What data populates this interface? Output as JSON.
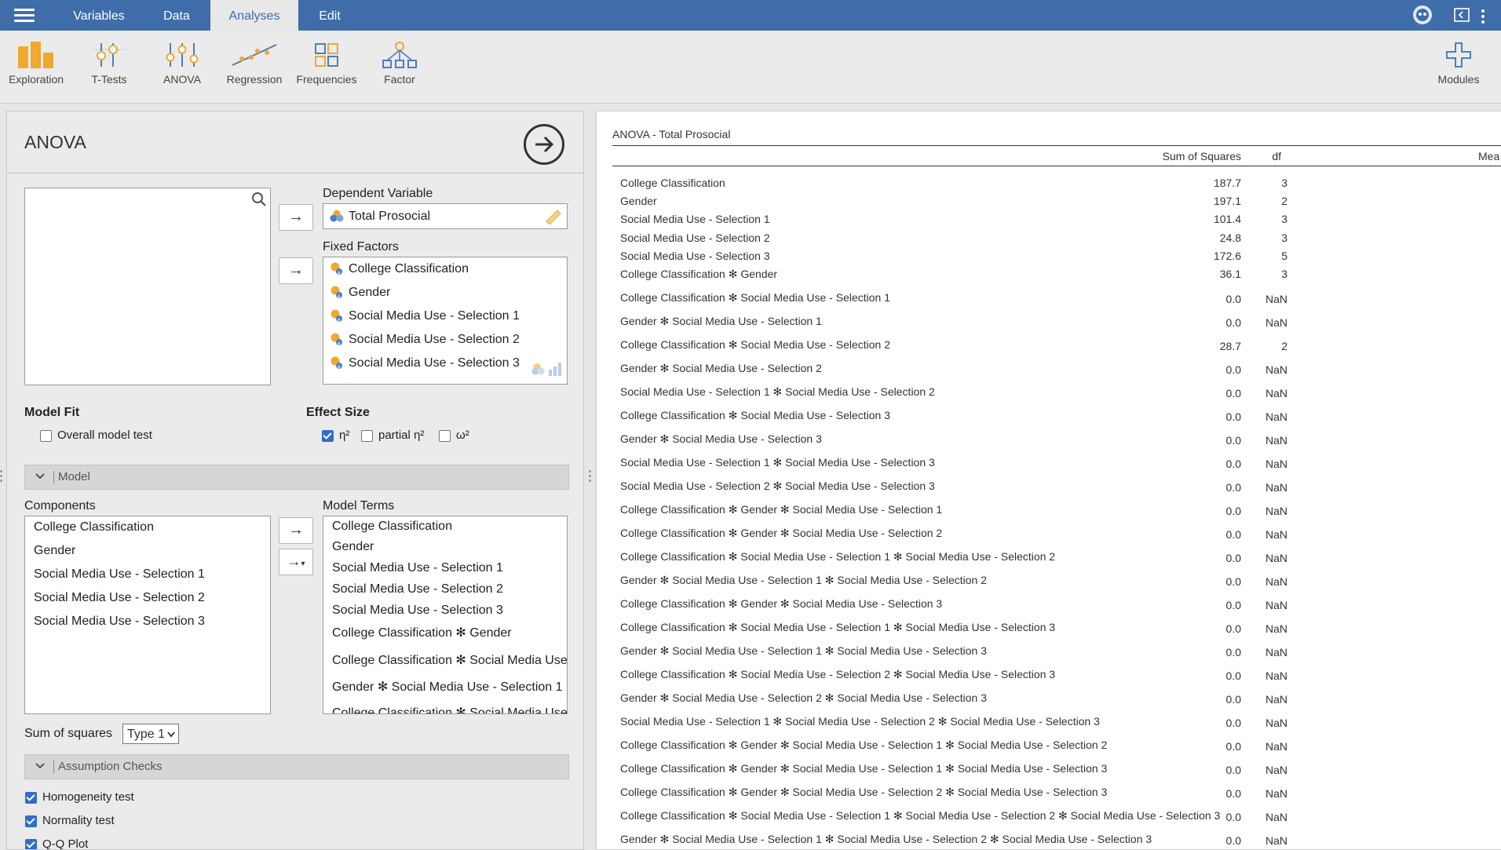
{
  "menu": {
    "tabs": [
      {
        "label": "Variables",
        "active": false
      },
      {
        "label": "Data",
        "active": false
      },
      {
        "label": "Analyses",
        "active": true
      },
      {
        "label": "Edit",
        "active": false
      }
    ]
  },
  "ribbon": {
    "buttons": [
      {
        "label": "Exploration",
        "icon": "bar-chart-icon"
      },
      {
        "label": "T-Tests",
        "icon": "t-tests-icon"
      },
      {
        "label": "ANOVA",
        "icon": "anova-icon"
      },
      {
        "label": "Regression",
        "icon": "regression-icon"
      },
      {
        "label": "Frequencies",
        "icon": "frequencies-icon"
      },
      {
        "label": "Factor",
        "icon": "factor-icon"
      }
    ],
    "modules_label": "Modules"
  },
  "anova_panel": {
    "title": "ANOVA",
    "dependent_variable_label": "Dependent Variable",
    "dependent_variable": "Total Prosocial",
    "fixed_factors_label": "Fixed Factors",
    "fixed_factors": [
      "College Classification",
      "Gender",
      "Social Media Use - Selection 1",
      "Social Media Use - Selection 2",
      "Social Media Use - Selection 3"
    ],
    "model_fit": {
      "label": "Model Fit",
      "overall_model_test": {
        "label": "Overall model test",
        "checked": false
      }
    },
    "effect_size": {
      "label": "Effect Size",
      "options": [
        {
          "label": "η²",
          "checked": true
        },
        {
          "label": "partial η²",
          "checked": false
        },
        {
          "label": "ω²",
          "checked": false
        }
      ]
    },
    "model_section_title": "Model",
    "components_label": "Components",
    "components": [
      "College Classification",
      "Gender",
      "Social Media Use - Selection 1",
      "Social Media Use - Selection 2",
      "Social Media Use - Selection 3"
    ],
    "model_terms_label": "Model Terms",
    "model_terms": [
      "College Classification",
      "Gender",
      "Social Media Use - Selection 1",
      "Social Media Use - Selection 2",
      "Social Media Use - Selection 3",
      "College Classification ✻ Gender",
      "College Classification ✻ Social Media Use",
      "Gender ✻ Social Media Use - Selection 1",
      "College Classification ✻ Social Media Use"
    ],
    "sum_of_squares_label": "Sum of squares",
    "sum_of_squares_value": "Type 1",
    "assumption_checks_title": "Assumption Checks",
    "assumption_checks": [
      {
        "label": "Homogeneity test",
        "checked": true
      },
      {
        "label": "Normality test",
        "checked": true
      },
      {
        "label": "Q-Q Plot",
        "checked": true
      }
    ]
  },
  "results": {
    "title": "ANOVA - Total Prosocial",
    "columns": [
      "Sum of Squares",
      "df",
      "Mea"
    ],
    "rows": [
      {
        "term": "College Classification",
        "ss": "187.7",
        "df": "3"
      },
      {
        "term": "Gender",
        "ss": "197.1",
        "df": "2"
      },
      {
        "term": "Social Media Use - Selection 1",
        "ss": "101.4",
        "df": "3"
      },
      {
        "term": "Social Media Use - Selection 2",
        "ss": "24.8",
        "df": "3"
      },
      {
        "term": "Social Media Use - Selection 3",
        "ss": "172.6",
        "df": "5"
      },
      {
        "term": "College Classification ✻ Gender",
        "ss": "36.1",
        "df": "3"
      },
      {
        "term": "College Classification ✻ Social Media Use - Selection 1",
        "ss": "0.0",
        "df": "NaN"
      },
      {
        "term": "Gender ✻ Social Media Use - Selection 1",
        "ss": "0.0",
        "df": "NaN"
      },
      {
        "term": "College Classification ✻ Social Media Use - Selection 2",
        "ss": "28.7",
        "df": "2"
      },
      {
        "term": "Gender ✻ Social Media Use - Selection 2",
        "ss": "0.0",
        "df": "NaN"
      },
      {
        "term": "Social Media Use - Selection 1 ✻ Social Media Use - Selection 2",
        "ss": "0.0",
        "df": "NaN"
      },
      {
        "term": "College Classification ✻ Social Media Use - Selection 3",
        "ss": "0.0",
        "df": "NaN"
      },
      {
        "term": "Gender ✻ Social Media Use - Selection 3",
        "ss": "0.0",
        "df": "NaN"
      },
      {
        "term": "Social Media Use - Selection 1 ✻ Social Media Use - Selection 3",
        "ss": "0.0",
        "df": "NaN"
      },
      {
        "term": "Social Media Use - Selection 2 ✻ Social Media Use - Selection 3",
        "ss": "0.0",
        "df": "NaN"
      },
      {
        "term": "College Classification ✻ Gender ✻ Social Media Use - Selection 1",
        "ss": "0.0",
        "df": "NaN"
      },
      {
        "term": "College Classification ✻ Gender ✻ Social Media Use - Selection 2",
        "ss": "0.0",
        "df": "NaN"
      },
      {
        "term": "College Classification ✻ Social Media Use - Selection 1 ✻ Social Media Use - Selection 2",
        "ss": "0.0",
        "df": "NaN"
      },
      {
        "term": "Gender ✻ Social Media Use - Selection 1 ✻ Social Media Use - Selection 2",
        "ss": "0.0",
        "df": "NaN"
      },
      {
        "term": "College Classification ✻ Gender ✻ Social Media Use - Selection 3",
        "ss": "0.0",
        "df": "NaN"
      },
      {
        "term": "College Classification ✻ Social Media Use - Selection 1 ✻ Social Media Use - Selection 3",
        "ss": "0.0",
        "df": "NaN"
      },
      {
        "term": "Gender ✻ Social Media Use - Selection 1 ✻ Social Media Use - Selection 3",
        "ss": "0.0",
        "df": "NaN"
      },
      {
        "term": "College Classification ✻ Social Media Use - Selection 2 ✻ Social Media Use - Selection 3",
        "ss": "0.0",
        "df": "NaN"
      },
      {
        "term": "Gender ✻ Social Media Use - Selection 2 ✻ Social Media Use - Selection 3",
        "ss": "0.0",
        "df": "NaN"
      },
      {
        "term": "Social Media Use - Selection 1 ✻ Social Media Use - Selection 2 ✻ Social Media Use - Selection 3",
        "ss": "0.0",
        "df": "NaN"
      },
      {
        "term": "College Classification ✻ Gender ✻ Social Media Use - Selection 1 ✻ Social Media Use - Selection 2",
        "ss": "0.0",
        "df": "NaN"
      },
      {
        "term": "College Classification ✻ Gender ✻ Social Media Use - Selection 1 ✻ Social Media Use - Selection 3",
        "ss": "0.0",
        "df": "NaN"
      },
      {
        "term": "College Classification ✻ Gender ✻ Social Media Use - Selection 2 ✻ Social Media Use - Selection 3",
        "ss": "0.0",
        "df": "NaN"
      },
      {
        "term": "College Classification ✻ Social Media Use - Selection 1 ✻ Social Media Use - Selection 2 ✻ Social Media Use - Selection 3",
        "ss": "0.0",
        "df": "NaN"
      },
      {
        "term": "Gender ✻ Social Media Use - Selection 1 ✻ Social Media Use - Selection 2 ✻ Social Media Use - Selection 3",
        "ss": "0.0",
        "df": "NaN"
      }
    ]
  },
  "colors": {
    "menubar": "#3e6da9",
    "accent_orange": "#f0a830",
    "accent_blue": "#4a7ec4",
    "checkbox_blue": "#2f6dc8"
  }
}
